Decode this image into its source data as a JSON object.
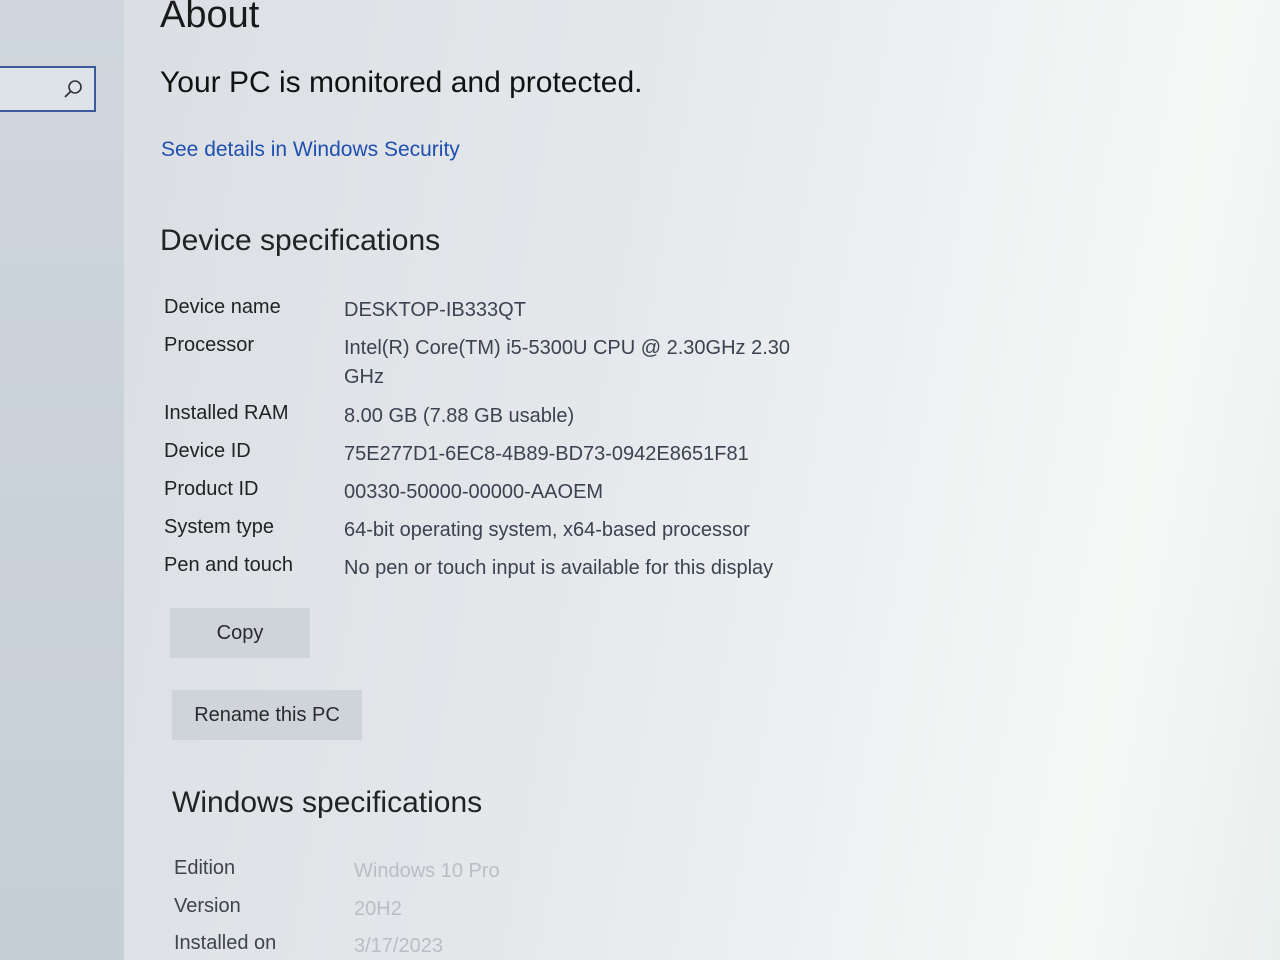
{
  "page": {
    "title": "About",
    "protection_status": "Your PC is monitored and protected.",
    "security_link": "See details in Windows Security"
  },
  "device_specs": {
    "heading": "Device specifications",
    "rows": [
      {
        "label": "Device name",
        "value": "DESKTOP-IB333QT"
      },
      {
        "label": "Processor",
        "value": "Intel(R) Core(TM) i5-5300U CPU @ 2.30GHz   2.30 GHz"
      },
      {
        "label": "Installed RAM",
        "value": "8.00 GB (7.88 GB usable)"
      },
      {
        "label": "Device ID",
        "value": "75E277D1-6EC8-4B89-BD73-0942E8651F81"
      },
      {
        "label": "Product ID",
        "value": "00330-50000-00000-AAOEM"
      },
      {
        "label": "System type",
        "value": "64-bit operating system, x64-based processor"
      },
      {
        "label": "Pen and touch",
        "value": "No pen or touch input is available for this display"
      }
    ],
    "copy_button": "Copy",
    "rename_button": "Rename this PC"
  },
  "windows_specs": {
    "heading": "Windows specifications",
    "rows": [
      {
        "label": "Edition",
        "value": "Windows 10 Pro"
      },
      {
        "label": "Version",
        "value": "20H2"
      },
      {
        "label": "Installed on",
        "value": "3/17/2023"
      }
    ]
  },
  "colors": {
    "link": "#1f4fb0",
    "search_border": "#3a5a9a",
    "button_bg": "#cfd4db"
  },
  "icons": {
    "search": "search-icon"
  }
}
